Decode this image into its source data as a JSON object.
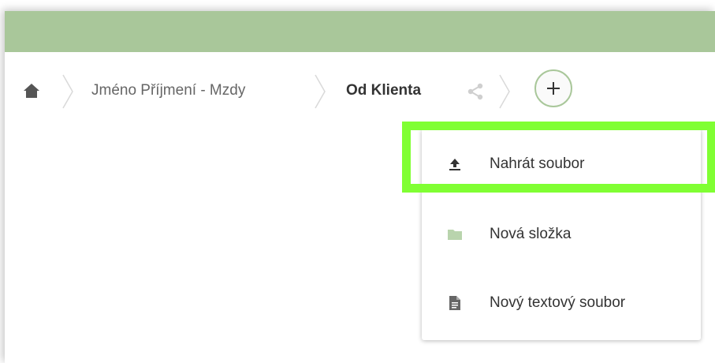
{
  "breadcrumb": {
    "home_icon": "home-icon",
    "items": [
      {
        "label": "Jméno Příjmení - Mzdy"
      },
      {
        "label": "Od Klienta"
      }
    ],
    "share_icon": "share-icon"
  },
  "add_button": {
    "icon": "plus-icon",
    "label": "+"
  },
  "menu": {
    "items": [
      {
        "label": "Nahrát soubor",
        "icon": "upload-icon"
      },
      {
        "label": "Nová složka",
        "icon": "folder-icon"
      },
      {
        "label": "Nový textový soubor",
        "icon": "text-file-icon"
      }
    ]
  },
  "colors": {
    "topbar": "#a9c79a",
    "highlight": "#80ff33",
    "folder": "#b9d4ad"
  }
}
